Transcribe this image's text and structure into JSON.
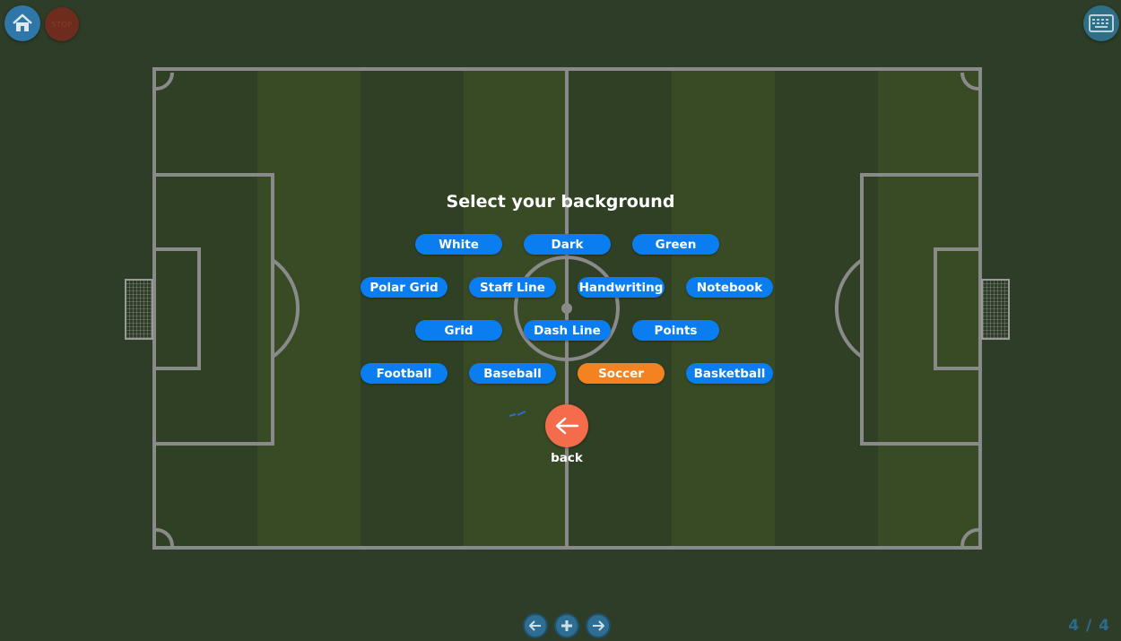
{
  "toolbar": {
    "home_icon": "home-icon",
    "stop_label": "STOP",
    "keyboard_icon": "keyboard-icon"
  },
  "panel": {
    "title": "Select your background",
    "options": [
      "White",
      "Dark",
      "Green",
      "Polar Grid",
      "Staff Line",
      "Handwriting",
      "Notebook",
      "Grid",
      "Dash Line",
      "Points",
      "Football",
      "Baseball",
      "Soccer",
      "Basketball"
    ],
    "selected": "Soccer",
    "back_label": "back"
  },
  "pager": {
    "text": "4 / 4",
    "prev_icon": "arrow-left-icon",
    "add_icon": "plus-icon",
    "next_icon": "arrow-right-icon"
  },
  "colors": {
    "background": "#2e3d27",
    "option": "#0a7ef0",
    "option_selected": "#f58220",
    "back_button": "#f46c4c",
    "field_line": "#8a8a8a"
  }
}
